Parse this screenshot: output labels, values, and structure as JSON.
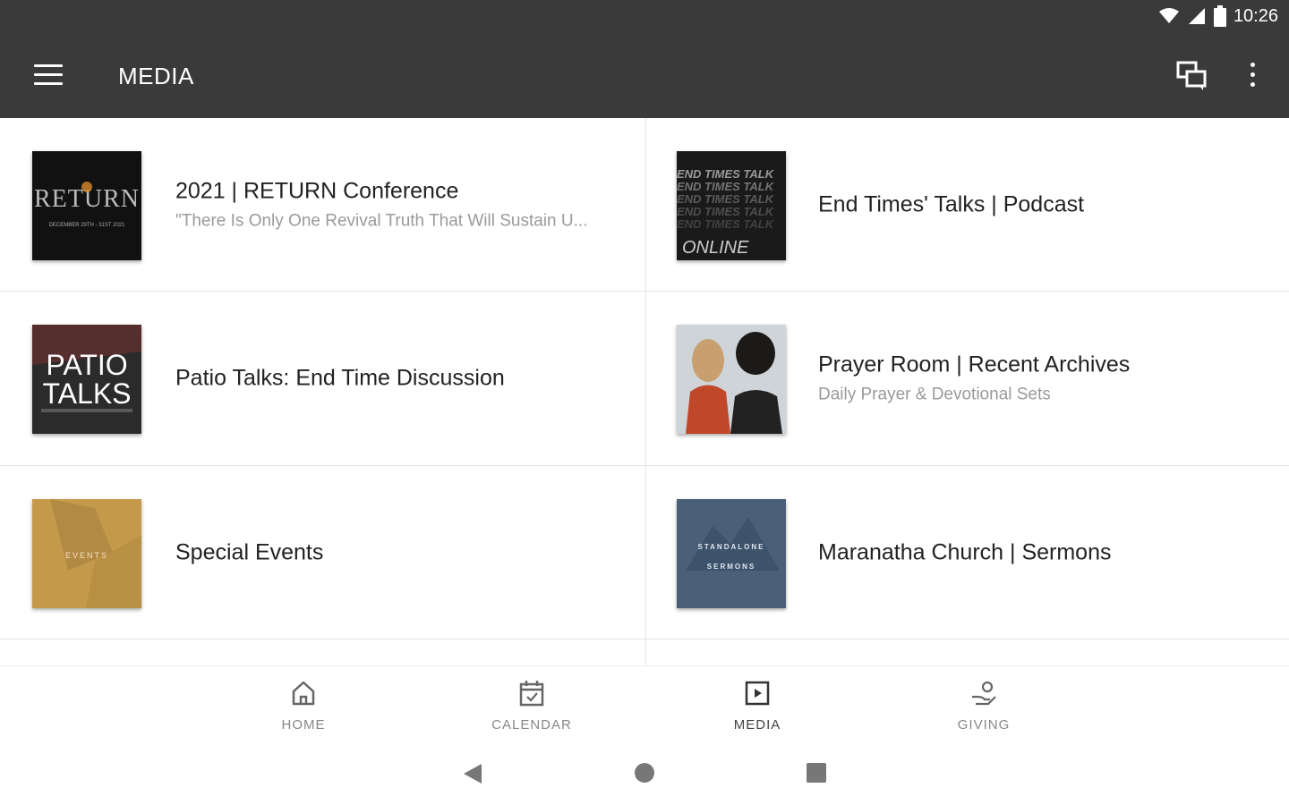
{
  "status": {
    "time": "10:26",
    "icons": [
      "wifi-icon",
      "signal-icon",
      "battery-icon"
    ]
  },
  "appbar": {
    "title": "MEDIA",
    "menu_icon": "menu-icon",
    "chat_icon": "chat-icon",
    "more_icon": "more-vert-icon"
  },
  "items": [
    {
      "title": "2021 | RETURN Conference",
      "subtitle": "\"There Is Only One Revival Truth That Will Sustain U...",
      "thumb_text": "RETURN",
      "thumb_sub": "DECEMBER 29TH - 31ST 2021",
      "thumb_bg": "#111111"
    },
    {
      "title": "End Times' Talks | Podcast",
      "subtitle": "",
      "thumb_text": "END TIMES TALK",
      "thumb_sub": "ONLINE",
      "thumb_bg": "#1a1a1a"
    },
    {
      "title": "Patio Talks: End Time Discussion",
      "subtitle": "",
      "thumb_text": "PATIO",
      "thumb_text2": "TALKS",
      "thumb_bg": "#2b2b2b"
    },
    {
      "title": "Prayer Room | Recent Archives",
      "subtitle": "Daily Prayer & Devotional Sets",
      "thumb_bg": "#c8cdd2"
    },
    {
      "title": "Special Events",
      "subtitle": "",
      "thumb_text": "EVENTS",
      "thumb_bg": "#c49a4a"
    },
    {
      "title": "Maranatha Church | Sermons",
      "subtitle": "",
      "thumb_text": "STANDALONE",
      "thumb_sub": "SERMONS",
      "thumb_bg": "#4a6078"
    }
  ],
  "bottom_nav": [
    {
      "label": "HOME",
      "icon": "home-icon"
    },
    {
      "label": "CALENDAR",
      "icon": "calendar-icon"
    },
    {
      "label": "MEDIA",
      "icon": "media-icon"
    },
    {
      "label": "GIVING",
      "icon": "giving-icon"
    }
  ],
  "system_nav": [
    "back-icon",
    "home-circle-icon",
    "recents-icon"
  ],
  "colors": {
    "appbar": "#3a3a3a",
    "divider": "#e4e4e4",
    "nav_label": "#888888"
  }
}
